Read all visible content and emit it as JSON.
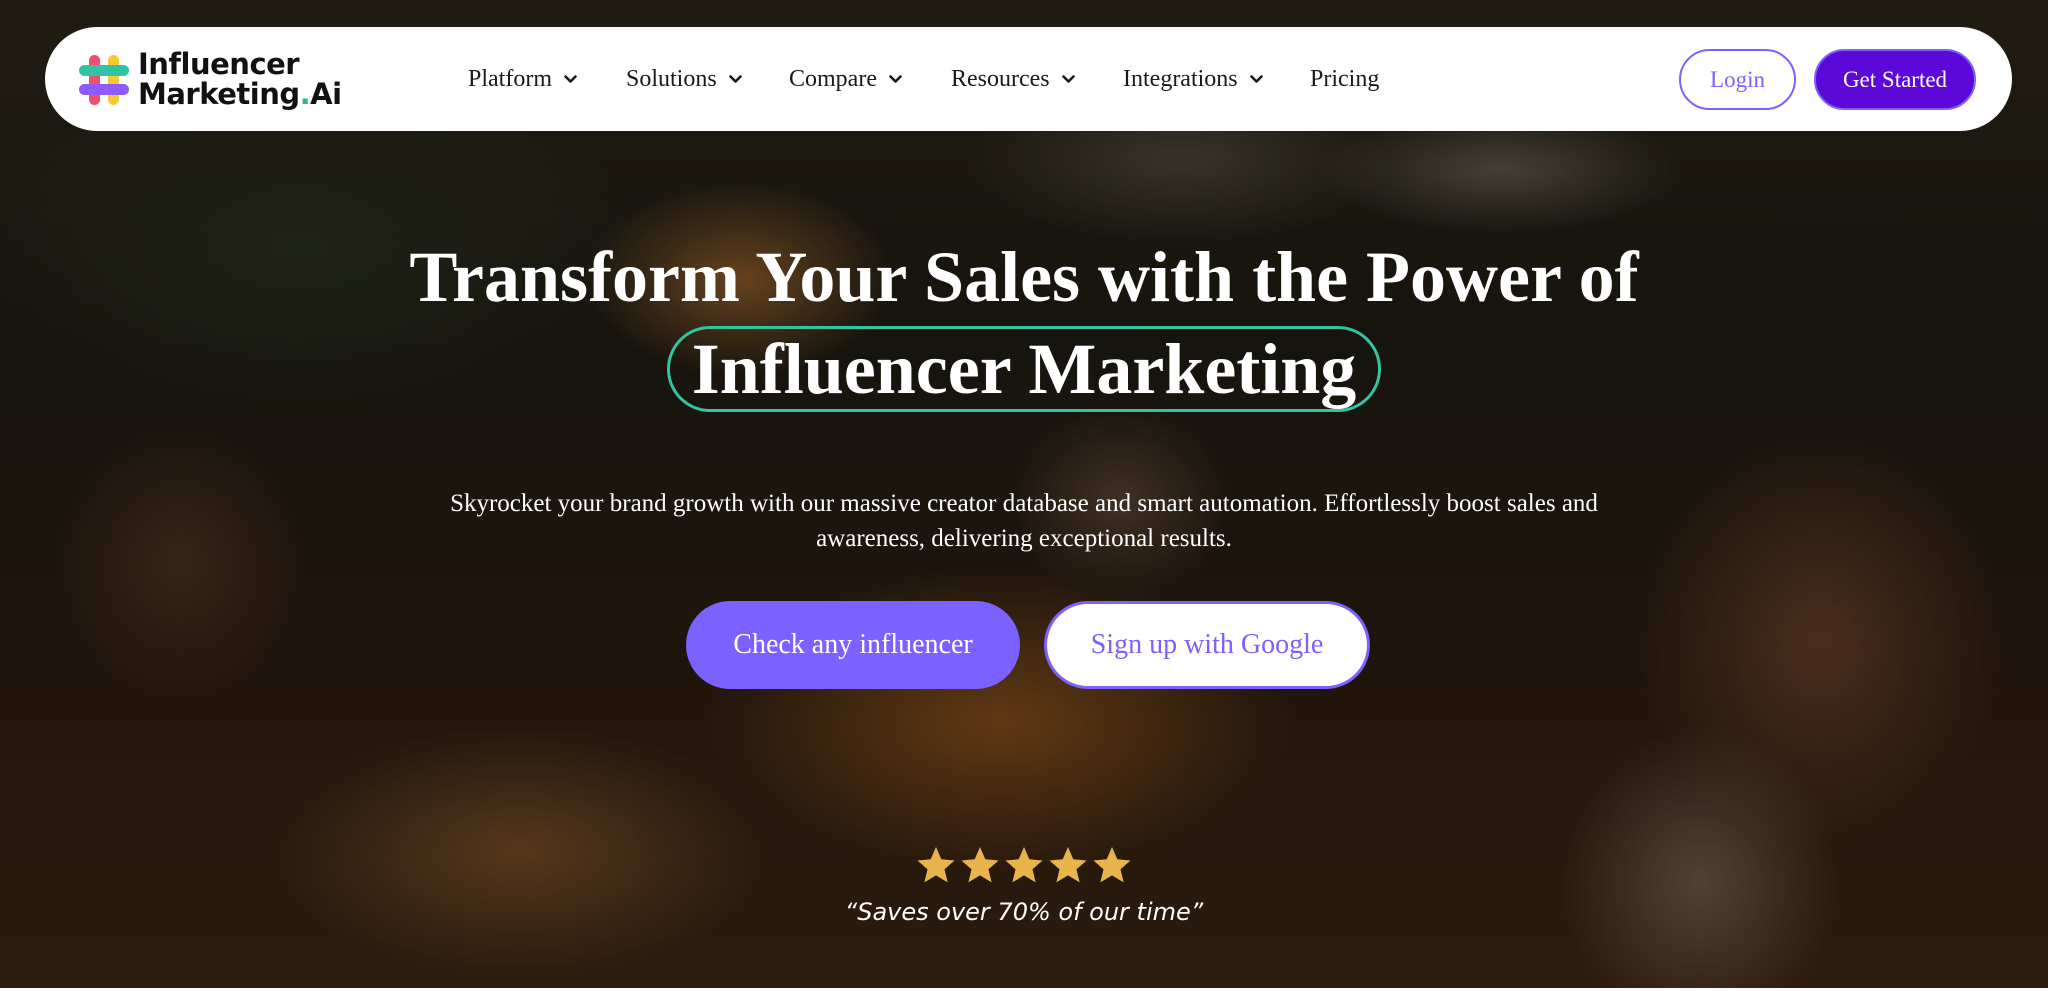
{
  "nav": {
    "logo_line1": "Influencer",
    "logo_line2": "Marketing",
    "logo_dot": ".",
    "logo_suffix": "Ai",
    "items": [
      {
        "label": "Platform",
        "has_dropdown": true
      },
      {
        "label": "Solutions",
        "has_dropdown": true
      },
      {
        "label": "Compare",
        "has_dropdown": true
      },
      {
        "label": "Resources",
        "has_dropdown": true
      },
      {
        "label": "Integrations",
        "has_dropdown": true
      },
      {
        "label": "Pricing",
        "has_dropdown": false
      }
    ],
    "login_label": "Login",
    "get_started_label": "Get Started"
  },
  "hero": {
    "headline": "Transform Your Sales with the Power of",
    "highlight": "Influencer Marketing",
    "subtext": "Skyrocket your brand growth with our massive creator database and smart automation. Effortlessly boost sales and awareness, delivering exceptional results.",
    "primary_cta": "Check any influencer",
    "secondary_cta": "Sign up with Google",
    "rating_stars": 5,
    "rating_max": 5,
    "testimonial": "“Saves over 70% of our time”"
  },
  "colors": {
    "brand_purple": "#7b61ff",
    "brand_deep_purple": "#5b08d9",
    "highlight_teal": "#34c3a0",
    "star_gold": "#e9b44c",
    "logo_teal": "#2bb597"
  },
  "icons": {
    "logo": "hashtag-logo-icon",
    "dropdown": "chevron-down-icon",
    "rating": "star-icon"
  }
}
